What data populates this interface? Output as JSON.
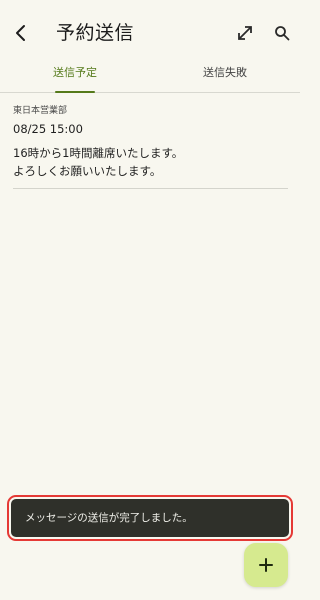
{
  "header": {
    "title": "予約送信",
    "back_icon": "back-chevron-icon",
    "expand_icon": "expand-arrows-icon",
    "search_icon": "search-icon"
  },
  "tabs": [
    {
      "label": "送信予定",
      "active": true
    },
    {
      "label": "送信失敗",
      "active": false
    }
  ],
  "messages": [
    {
      "sender": "東日本営業部",
      "datetime": "08/25 15:00",
      "body_lines": [
        "16時から1時間離席いたします。",
        "よろしくお願いいたします。"
      ]
    }
  ],
  "snackbar": {
    "text": "メッセージの送信が完了しました。"
  },
  "fab": {
    "icon": "plus-icon"
  },
  "colors": {
    "background": "#f8f7ef",
    "accent": "#557a1a",
    "fab": "#d6ea8f",
    "snackbar": "#2f302a",
    "highlight": "#e53935"
  }
}
